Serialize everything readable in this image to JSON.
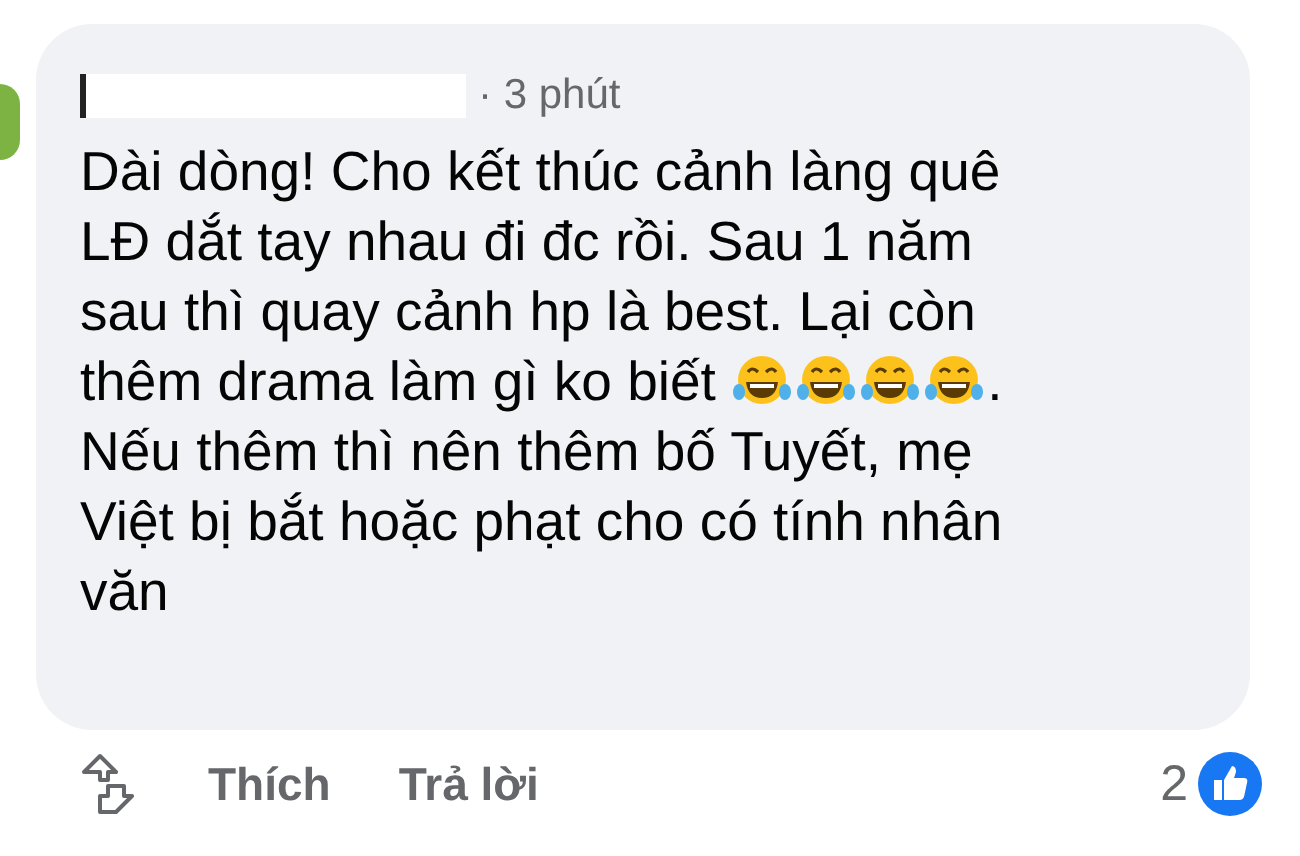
{
  "comment": {
    "time": "· 3 phút",
    "body": [
      {
        "kind": "text",
        "text": "Dài dòng! Cho kết thúc cảnh làng quê\nLĐ dắt tay nhau đi đc rồi. Sau 1 năm\nsau thì quay cảnh hp là best. Lại còn\nthêm drama làm gì ko biết "
      },
      {
        "kind": "emoji"
      },
      {
        "kind": "emoji"
      },
      {
        "kind": "emoji"
      },
      {
        "kind": "emoji"
      },
      {
        "kind": "text",
        "text": ".\nNếu thêm thì nên thêm bố Tuyết, mẹ\nViệt bị bắt hoặc phạt cho có tính nhân\nvăn"
      }
    ]
  },
  "actions": [
    {
      "label": "Thích"
    },
    {
      "label": "Trả lời"
    }
  ],
  "reactions": {
    "count": "2"
  }
}
